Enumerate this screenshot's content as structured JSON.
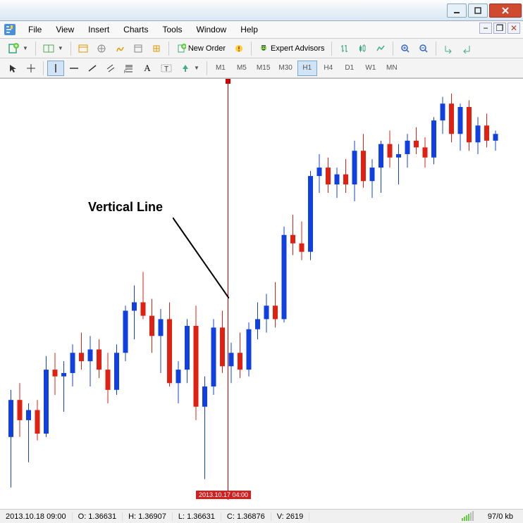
{
  "menu": {
    "file": "File",
    "view": "View",
    "insert": "Insert",
    "charts": "Charts",
    "tools": "Tools",
    "window": "Window",
    "help": "Help"
  },
  "toolbar": {
    "new_order": "New Order",
    "expert_advisors": "Expert Advisors"
  },
  "timeframes": {
    "m1": "M1",
    "m5": "M5",
    "m15": "M15",
    "m30": "M30",
    "h1": "H1",
    "h4": "H4",
    "d1": "D1",
    "w1": "W1",
    "mn": "MN"
  },
  "annotation": {
    "label": "Vertical Line"
  },
  "vline": {
    "date": "2013.10.17 04:00"
  },
  "status": {
    "time": "2013.10.18 09:00",
    "O": "O: 1.36631",
    "H": "H: 1.36907",
    "L": "L: 1.36631",
    "C": "C: 1.36876",
    "V": "V: 2619",
    "kb": "97/0 kb"
  },
  "chart_data": {
    "type": "candlestick",
    "title": "",
    "xlabel": "",
    "ylabel": "",
    "ylim": [
      1.348,
      1.373
    ],
    "x_time_range": [
      "2013.10.15",
      "2013.10.20"
    ],
    "annotation": {
      "text": "Vertical Line",
      "target_time": "2013.10.17 04:00"
    },
    "candles": [
      {
        "i": 0,
        "o": 1.352,
        "h": 1.3548,
        "l": 1.349,
        "c": 1.3542,
        "col": "bull"
      },
      {
        "i": 1,
        "o": 1.3542,
        "h": 1.3552,
        "l": 1.352,
        "c": 1.353,
        "col": "bear"
      },
      {
        "i": 2,
        "o": 1.353,
        "h": 1.354,
        "l": 1.3505,
        "c": 1.3536,
        "col": "bull"
      },
      {
        "i": 3,
        "o": 1.3536,
        "h": 1.3542,
        "l": 1.3518,
        "c": 1.3522,
        "col": "bear"
      },
      {
        "i": 4,
        "o": 1.3522,
        "h": 1.3568,
        "l": 1.352,
        "c": 1.356,
        "col": "bull"
      },
      {
        "i": 5,
        "o": 1.356,
        "h": 1.357,
        "l": 1.3545,
        "c": 1.3556,
        "col": "bear"
      },
      {
        "i": 6,
        "o": 1.3556,
        "h": 1.3565,
        "l": 1.3535,
        "c": 1.3558,
        "col": "bull"
      },
      {
        "i": 7,
        "o": 1.3558,
        "h": 1.3575,
        "l": 1.355,
        "c": 1.357,
        "col": "bull"
      },
      {
        "i": 8,
        "o": 1.357,
        "h": 1.3582,
        "l": 1.356,
        "c": 1.3565,
        "col": "bear"
      },
      {
        "i": 9,
        "o": 1.3565,
        "h": 1.358,
        "l": 1.355,
        "c": 1.3572,
        "col": "bull"
      },
      {
        "i": 10,
        "o": 1.3572,
        "h": 1.3578,
        "l": 1.3555,
        "c": 1.356,
        "col": "bear"
      },
      {
        "i": 11,
        "o": 1.356,
        "h": 1.357,
        "l": 1.354,
        "c": 1.3548,
        "col": "bear"
      },
      {
        "i": 12,
        "o": 1.3548,
        "h": 1.3575,
        "l": 1.3545,
        "c": 1.357,
        "col": "bull"
      },
      {
        "i": 13,
        "o": 1.357,
        "h": 1.3598,
        "l": 1.3565,
        "c": 1.3595,
        "col": "bull"
      },
      {
        "i": 14,
        "o": 1.3595,
        "h": 1.361,
        "l": 1.3578,
        "c": 1.36,
        "col": "bull"
      },
      {
        "i": 15,
        "o": 1.36,
        "h": 1.3618,
        "l": 1.359,
        "c": 1.3592,
        "col": "bear"
      },
      {
        "i": 16,
        "o": 1.3592,
        "h": 1.3602,
        "l": 1.357,
        "c": 1.358,
        "col": "bear"
      },
      {
        "i": 17,
        "o": 1.358,
        "h": 1.3596,
        "l": 1.3558,
        "c": 1.359,
        "col": "bull"
      },
      {
        "i": 18,
        "o": 1.359,
        "h": 1.36,
        "l": 1.355,
        "c": 1.3552,
        "col": "bear"
      },
      {
        "i": 19,
        "o": 1.3552,
        "h": 1.3565,
        "l": 1.354,
        "c": 1.356,
        "col": "bull"
      },
      {
        "i": 20,
        "o": 1.356,
        "h": 1.359,
        "l": 1.3552,
        "c": 1.3586,
        "col": "bull"
      },
      {
        "i": 21,
        "o": 1.3586,
        "h": 1.3598,
        "l": 1.353,
        "c": 1.3538,
        "col": "bear"
      },
      {
        "i": 22,
        "o": 1.3538,
        "h": 1.3556,
        "l": 1.3495,
        "c": 1.355,
        "col": "bull"
      },
      {
        "i": 23,
        "o": 1.355,
        "h": 1.359,
        "l": 1.3545,
        "c": 1.3585,
        "col": "bull"
      },
      {
        "i": 24,
        "o": 1.3585,
        "h": 1.3595,
        "l": 1.3558,
        "c": 1.3562,
        "col": "bear"
      },
      {
        "i": 25,
        "o": 1.3562,
        "h": 1.3576,
        "l": 1.3552,
        "c": 1.357,
        "col": "bull"
      },
      {
        "i": 26,
        "o": 1.357,
        "h": 1.3582,
        "l": 1.3555,
        "c": 1.356,
        "col": "bear"
      },
      {
        "i": 27,
        "o": 1.356,
        "h": 1.3588,
        "l": 1.3556,
        "c": 1.3584,
        "col": "bull"
      },
      {
        "i": 28,
        "o": 1.3584,
        "h": 1.36,
        "l": 1.3578,
        "c": 1.359,
        "col": "bull"
      },
      {
        "i": 29,
        "o": 1.359,
        "h": 1.3605,
        "l": 1.3582,
        "c": 1.3598,
        "col": "bull"
      },
      {
        "i": 30,
        "o": 1.3598,
        "h": 1.3612,
        "l": 1.3585,
        "c": 1.359,
        "col": "bear"
      },
      {
        "i": 31,
        "o": 1.359,
        "h": 1.3645,
        "l": 1.3588,
        "c": 1.364,
        "col": "bull"
      },
      {
        "i": 32,
        "o": 1.364,
        "h": 1.3652,
        "l": 1.3628,
        "c": 1.3635,
        "col": "bear"
      },
      {
        "i": 33,
        "o": 1.3635,
        "h": 1.3648,
        "l": 1.3625,
        "c": 1.363,
        "col": "bear"
      },
      {
        "i": 34,
        "o": 1.363,
        "h": 1.3678,
        "l": 1.3625,
        "c": 1.3675,
        "col": "bull"
      },
      {
        "i": 35,
        "o": 1.3675,
        "h": 1.3688,
        "l": 1.3665,
        "c": 1.368,
        "col": "bull"
      },
      {
        "i": 36,
        "o": 1.368,
        "h": 1.3686,
        "l": 1.3665,
        "c": 1.367,
        "col": "bear"
      },
      {
        "i": 37,
        "o": 1.367,
        "h": 1.368,
        "l": 1.3662,
        "c": 1.3676,
        "col": "bull"
      },
      {
        "i": 38,
        "o": 1.3676,
        "h": 1.3685,
        "l": 1.3665,
        "c": 1.367,
        "col": "bear"
      },
      {
        "i": 39,
        "o": 1.367,
        "h": 1.3696,
        "l": 1.366,
        "c": 1.369,
        "col": "bull"
      },
      {
        "i": 40,
        "o": 1.369,
        "h": 1.37,
        "l": 1.3668,
        "c": 1.3672,
        "col": "bear"
      },
      {
        "i": 41,
        "o": 1.3672,
        "h": 1.3685,
        "l": 1.3662,
        "c": 1.368,
        "col": "bull"
      },
      {
        "i": 42,
        "o": 1.368,
        "h": 1.3696,
        "l": 1.3665,
        "c": 1.3694,
        "col": "bull"
      },
      {
        "i": 43,
        "o": 1.3694,
        "h": 1.3702,
        "l": 1.368,
        "c": 1.3686,
        "col": "bear"
      },
      {
        "i": 44,
        "o": 1.3686,
        "h": 1.3694,
        "l": 1.367,
        "c": 1.3688,
        "col": "bull"
      },
      {
        "i": 45,
        "o": 1.3688,
        "h": 1.37,
        "l": 1.368,
        "c": 1.3696,
        "col": "bull"
      },
      {
        "i": 46,
        "o": 1.3696,
        "h": 1.3704,
        "l": 1.3688,
        "c": 1.3692,
        "col": "bear"
      },
      {
        "i": 47,
        "o": 1.3692,
        "h": 1.3698,
        "l": 1.368,
        "c": 1.3686,
        "col": "bear"
      },
      {
        "i": 48,
        "o": 1.3686,
        "h": 1.371,
        "l": 1.3682,
        "c": 1.3708,
        "col": "bull"
      },
      {
        "i": 49,
        "o": 1.3708,
        "h": 1.3722,
        "l": 1.37,
        "c": 1.3718,
        "col": "bull"
      },
      {
        "i": 50,
        "o": 1.3718,
        "h": 1.3724,
        "l": 1.3695,
        "c": 1.37,
        "col": "bear"
      },
      {
        "i": 51,
        "o": 1.37,
        "h": 1.3718,
        "l": 1.369,
        "c": 1.3716,
        "col": "bull"
      },
      {
        "i": 52,
        "o": 1.3716,
        "h": 1.372,
        "l": 1.369,
        "c": 1.3695,
        "col": "bear"
      },
      {
        "i": 53,
        "o": 1.3695,
        "h": 1.371,
        "l": 1.3688,
        "c": 1.3705,
        "col": "bull"
      },
      {
        "i": 54,
        "o": 1.3705,
        "h": 1.3712,
        "l": 1.3692,
        "c": 1.3696,
        "col": "bear"
      },
      {
        "i": 55,
        "o": 1.3696,
        "h": 1.3702,
        "l": 1.369,
        "c": 1.37,
        "col": "bull"
      }
    ]
  }
}
